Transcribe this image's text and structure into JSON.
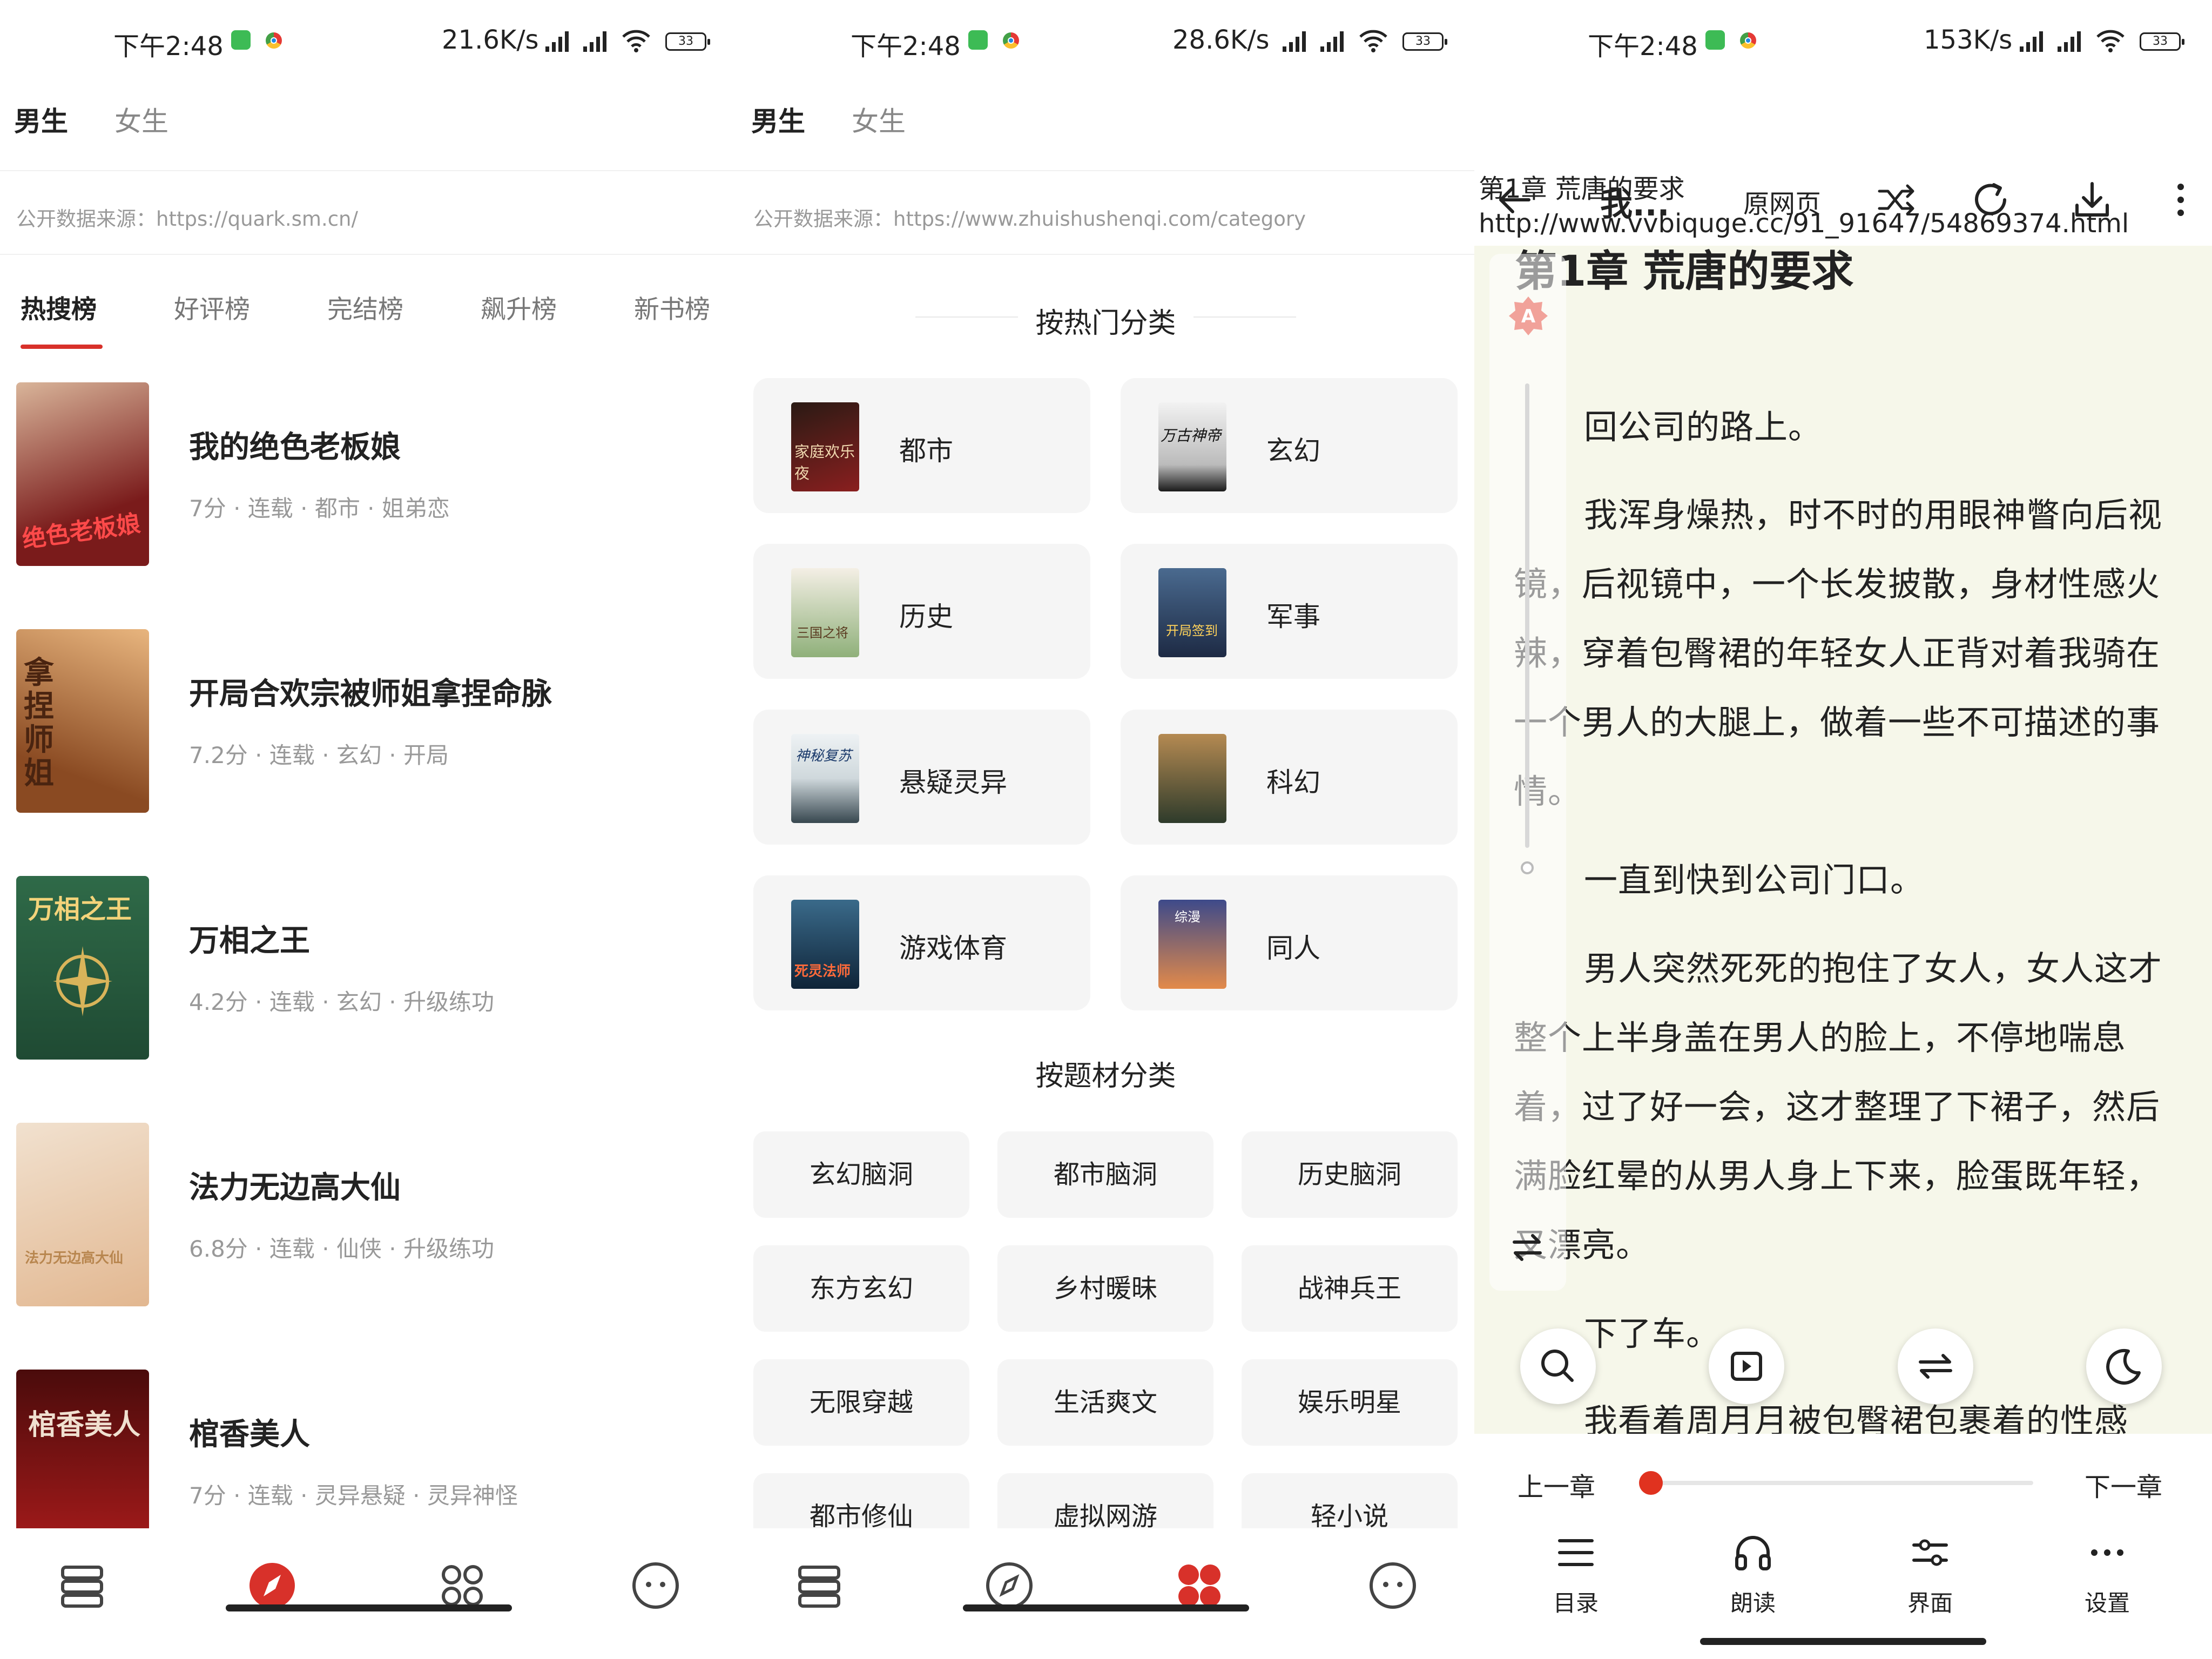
{
  "status_bars": [
    {
      "time": "下午2:48",
      "speed": "21.6K/s",
      "battery": "33"
    },
    {
      "time": "下午2:48",
      "speed": "28.6K/s",
      "battery": "33"
    },
    {
      "time": "下午2:48",
      "speed": "153K/s",
      "battery": "33"
    }
  ],
  "screen1": {
    "gender_tabs": [
      "男生",
      "女生"
    ],
    "source": "公开数据来源：https://quark.sm.cn/",
    "rank_tabs": [
      "热搜榜",
      "好评榜",
      "完结榜",
      "飙升榜",
      "新书榜"
    ],
    "books": [
      {
        "title": "我的绝色老板娘",
        "meta": "7分 · 连载 · 都市 · 姐弟恋",
        "cover_text": "绝色老板娘",
        "cover_colors": [
          "#7a1b1b",
          "#d9b59a"
        ]
      },
      {
        "title": "开局合欢宗被师姐拿捏命脉",
        "meta": "7.2分 · 连载 · 玄幻 · 开局",
        "cover_text": "拿捏师姐",
        "cover_colors": [
          "#8a4a22",
          "#e8b57e"
        ]
      },
      {
        "title": "万相之王",
        "meta": "4.2分 · 连载 · 玄幻 · 升级练功",
        "cover_text": "万相之王",
        "cover_colors": [
          "#1f4a33",
          "#2f6a48"
        ]
      },
      {
        "title": "法力无边高大仙",
        "meta": "6.8分 · 连载 · 仙侠 · 升级练功",
        "cover_text": "法力无边高大仙",
        "cover_colors": [
          "#f1e1cf",
          "#e2b790"
        ]
      },
      {
        "title": "棺香美人",
        "meta": "7分 · 连载 · 灵异悬疑 · 灵异神怪",
        "cover_text": "棺香美人",
        "cover_colors": [
          "#4a0b0b",
          "#a81b1b"
        ]
      }
    ]
  },
  "screen2": {
    "gender_tabs": [
      "男生",
      "女生"
    ],
    "source": "公开数据来源：https://www.zhuishushenqi.com/category",
    "hot_section": "按热门分类",
    "hot_categories": [
      {
        "label": "都市",
        "cover_text": "家庭欢乐夜",
        "colors": [
          "#2a1a14",
          "#8a1f1f"
        ]
      },
      {
        "label": "玄幻",
        "cover_text": "万古神帝",
        "colors": [
          "#f2f2f2",
          "#1a1a1a"
        ]
      },
      {
        "label": "历史",
        "cover_text": "三国之将",
        "colors": [
          "#f4efe5",
          "#8fb07a"
        ]
      },
      {
        "label": "军事",
        "cover_text": "开局签到",
        "colors": [
          "#1d2a44",
          "#4a6a8f"
        ]
      },
      {
        "label": "悬疑灵异",
        "cover_text": "神秘复苏",
        "colors": [
          "#cfd8dc",
          "#37474f"
        ]
      },
      {
        "label": "科幻",
        "cover_text": "",
        "colors": [
          "#2e3b2b",
          "#b58a52"
        ]
      },
      {
        "label": "游戏体育",
        "cover_text": "死灵法师",
        "colors": [
          "#0f2438",
          "#3a6a8a"
        ]
      },
      {
        "label": "同人",
        "cover_text": "综漫",
        "colors": [
          "#3d4a8a",
          "#e28a4a"
        ]
      }
    ],
    "theme_section": "按题材分类",
    "theme_categories": [
      "玄幻脑洞",
      "都市脑洞",
      "历史脑洞",
      "东方玄幻",
      "乡村暖昧",
      "战神兵王",
      "无限穿越",
      "生活爽文",
      "娱乐明星",
      "都市修仙",
      "虚拟网游",
      "轻小说"
    ]
  },
  "screen3": {
    "book_title": "我...",
    "original_page": "原网页",
    "chapter_line": "第1章 荒唐的要求",
    "url_line": "http://www.vvbiquge.cc/91_91647/54869374.html",
    "chapter_title": "第1章 荒唐的要求",
    "badge": "A",
    "paragraphs": [
      "回公司的路上。",
      "我浑身燥热，时不时的用眼神瞥向后视镜，后视镜中，一个长发披散，身材性感火辣，穿着包臀裙的年轻女人正背对着我骑在一个男人的大腿上，做着一些不可描述的事情。",
      "一直到快到公司门口。",
      "男人突然死死的抱住了女人，女人这才整个上半身盖在男人的脸上，不停地喘息着，过了好一会，这才整理了下裙子，然后满脸红晕的从男人身上下来，脸蛋既年轻，又漂亮。",
      "下了车。",
      "我看着周月月被包臀裙包裹着的性感"
    ],
    "prev_chapter": "上一章",
    "next_chapter": "下一章",
    "progress": 0.0,
    "tools": [
      "目录",
      "朗读",
      "界面",
      "设置"
    ]
  },
  "colors": {
    "accent": "#d8312a",
    "card": "#f5f5f5",
    "reader_bg": "#f6f7ea"
  }
}
